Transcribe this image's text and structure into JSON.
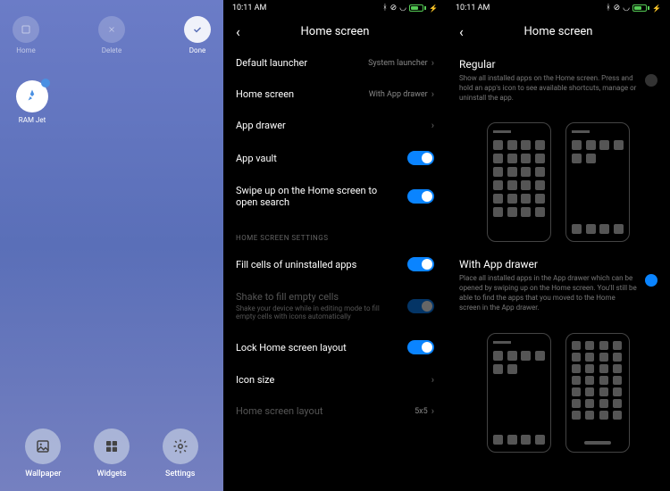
{
  "panel1": {
    "top_actions": [
      {
        "label": "Home",
        "icon": "home-icon"
      },
      {
        "label": "Delete",
        "icon": "close-icon"
      },
      {
        "label": "Done",
        "icon": "check-icon",
        "active": true
      }
    ],
    "app": {
      "name": "RAM Jet"
    },
    "bottom_actions": [
      {
        "label": "Wallpaper",
        "icon": "wallpaper-icon"
      },
      {
        "label": "Widgets",
        "icon": "widgets-icon"
      },
      {
        "label": "Settings",
        "icon": "settings-icon"
      }
    ]
  },
  "status": {
    "time": "10:11 AM"
  },
  "panel2": {
    "title": "Home screen",
    "items": [
      {
        "label": "Default launcher",
        "value": "System launcher",
        "type": "nav"
      },
      {
        "label": "Home screen",
        "value": "With App drawer",
        "type": "nav"
      },
      {
        "label": "App drawer",
        "value": "",
        "type": "nav"
      },
      {
        "label": "App vault",
        "type": "toggle",
        "on": true
      },
      {
        "label": "Swipe up on the Home screen to open search",
        "type": "toggle",
        "on": true
      }
    ],
    "section_header": "HOME SCREEN SETTINGS",
    "section_items": [
      {
        "label": "Fill cells of uninstalled apps",
        "type": "toggle",
        "on": true
      },
      {
        "label": "Shake to fill empty cells",
        "sub": "Shake your device while in editing mode to fill empty cells with icons automatically",
        "type": "toggle",
        "on": true,
        "disabled": true
      },
      {
        "label": "Lock Home screen layout",
        "type": "toggle",
        "on": true
      },
      {
        "label": "Icon size",
        "value": "",
        "type": "nav"
      },
      {
        "label": "Home screen layout",
        "value": "5x5",
        "type": "nav",
        "disabled": true
      }
    ]
  },
  "panel3": {
    "title": "Home screen",
    "options": [
      {
        "title": "Regular",
        "desc": "Show all installed apps on the Home screen. Press and hold an app's icon to see available shortcuts, manage or uninstall the app.",
        "selected": false
      },
      {
        "title": "With App drawer",
        "desc": "Place all installed apps in the App drawer which can be opened by swiping up on the Home screen. You'll still be able to find the apps that you moved to the Home screen in the App drawer.",
        "selected": true
      }
    ]
  }
}
